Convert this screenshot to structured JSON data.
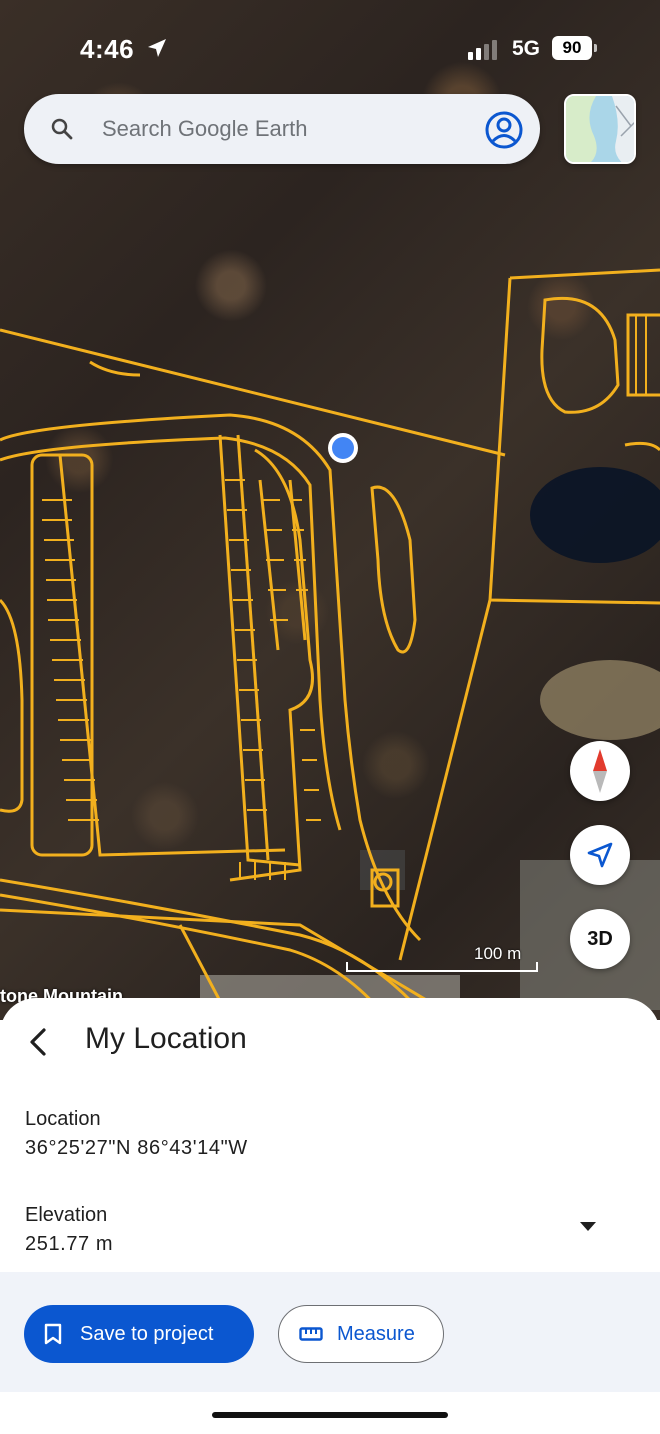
{
  "status_bar": {
    "time": "4:46",
    "network": "5G",
    "battery": "90"
  },
  "search": {
    "placeholder": "Search Google Earth"
  },
  "map": {
    "scale_label": "100 m",
    "place_label": "tone Mountain",
    "controls": {
      "three_d": "3D"
    }
  },
  "sheet": {
    "title": "My Location",
    "location_label": "Location",
    "location_value": "36°25'27\"N 86°43'14\"W",
    "elevation_label": "Elevation",
    "elevation_value": "251.77 m",
    "save_label": "Save to project",
    "measure_label": "Measure"
  },
  "colors": {
    "accent": "#0b57d0",
    "overlay_lines": "#f2b01e",
    "location_dot": "#4285f4"
  },
  "icons": {
    "search": "search-icon",
    "account": "account-circle-icon",
    "compass": "compass-icon",
    "locate": "navigation-arrow-icon",
    "back": "chevron-left-icon",
    "expand": "caret-down-icon",
    "save": "bookmark-icon",
    "measure": "ruler-icon"
  }
}
